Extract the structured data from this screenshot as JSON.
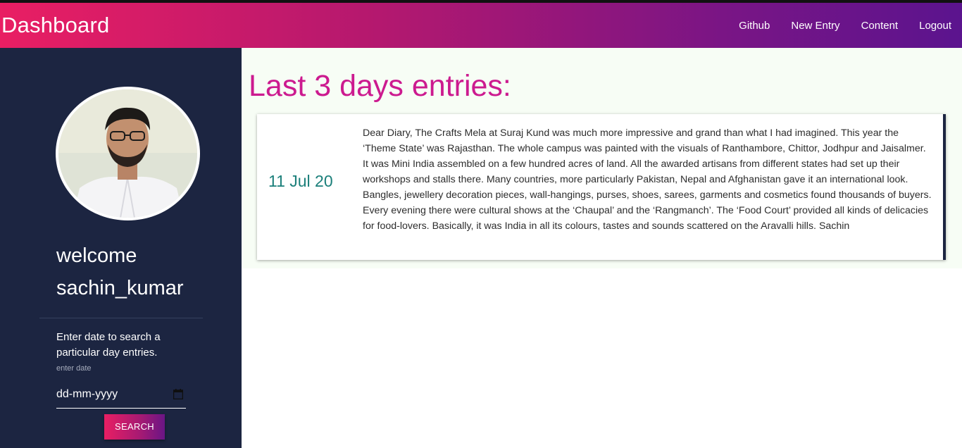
{
  "navbar": {
    "brand": "Dashboard",
    "links": [
      "Github",
      "New Entry",
      "Content",
      "Logout"
    ]
  },
  "sidebar": {
    "welcome_line1": "welcome",
    "username": "sachin_kumar",
    "search_hint": "Enter date to search a particular day entries.",
    "date_label": "enter date",
    "date_placeholder": "dd-mm-yyyy",
    "search_button": "SEARCH",
    "avatar_icon": "user-photo"
  },
  "main": {
    "title": "Last 3 days entries:",
    "entries": [
      {
        "date": "11 Jul 20",
        "text": "Dear Diary, The Crafts Mela at Suraj Kund was much more impressive and grand than what I had imagined. This year the ‘Theme State’ was Rajasthan. The whole campus was painted with the visuals of Ranthambore, Chittor, Jodhpur and Jaisalmer. It was Mini India assembled on a few hundred acres of land. All the awarded artisans from different states had set up their workshops and stalls there. Many countries, more particularly Pakistan, Nepal and Afghanistan gave it an international look. Bangles, jewellery decoration pieces, wall-hangings, purses, shoes, sarees, garments and cosmetics found thousands of buyers. Every evening there were cultural shows at the ‘Chaupal’ and the ‘Rangmanch’. The ‘Food Court’ provided all kinds of delicacies for food-lovers. Basically, it was India in all its colours, tastes and sounds scattered on the Aravalli hills. Sachin"
      }
    ]
  },
  "colors": {
    "navbar_start": "#e91e63",
    "navbar_end": "#5b148e",
    "sidebar_bg": "#1c2541",
    "title_color": "#cc1a8f",
    "date_color": "#1b7f7a"
  }
}
